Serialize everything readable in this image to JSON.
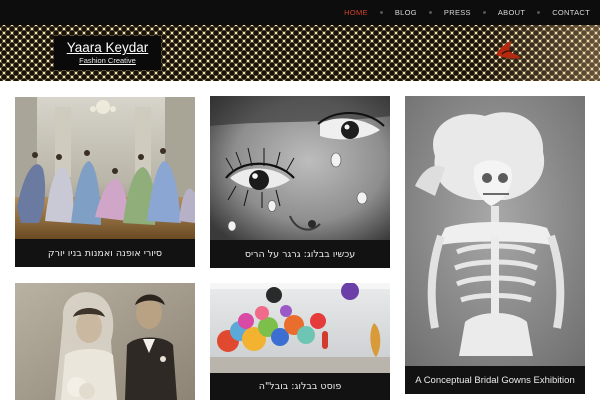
{
  "nav": {
    "items": [
      {
        "label": "HOME",
        "active": true
      },
      {
        "label": "BLOG",
        "active": false
      },
      {
        "label": "PRESS",
        "active": false
      },
      {
        "label": "ABOUT",
        "active": false
      },
      {
        "label": "CONTACT",
        "active": false
      }
    ],
    "active_color": "#d0402a"
  },
  "site": {
    "title": "Yaara Keydar",
    "subtitle": "Fashion Creative"
  },
  "posts": [
    {
      "caption": "סיורי אופנה ואמנות בניו יורק",
      "image": "ballroom-gowns-photo"
    },
    {
      "caption": "עכשיו בבלוג: גרגר על הריס",
      "image": "glass-tears-closeup-photo"
    },
    {
      "caption": "A Conceptual Bridal Gowns Exhibition",
      "image": "lace-skeleton-bride-photo"
    },
    {
      "caption": "",
      "image": "vintage-wedding-couple-photo"
    },
    {
      "caption": "פוסט בבלוג: בובל\"ה",
      "image": "pompom-installation-photo"
    }
  ]
}
